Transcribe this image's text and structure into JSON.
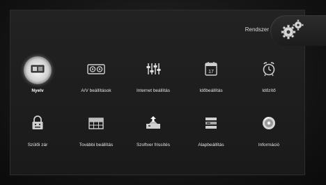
{
  "menu": {
    "title": "Rendszer"
  },
  "items": [
    {
      "label": "Nyelv",
      "icon": "language-icon",
      "selected": true
    },
    {
      "label": "A/V beállítások",
      "icon": "av-settings-icon"
    },
    {
      "label": "Internet beállítás",
      "icon": "internet-settings-icon"
    },
    {
      "label": "Időbeállítás",
      "icon": "calendar-icon",
      "calendar_day": "17"
    },
    {
      "label": "Időzítő",
      "icon": "alarm-clock-icon"
    },
    {
      "label": "Szülői zár",
      "icon": "parental-lock-icon"
    },
    {
      "label": "További beállítás",
      "icon": "more-settings-icon"
    },
    {
      "label": "Szoftver frissítés",
      "icon": "software-update-icon"
    },
    {
      "label": "Alapbeállítás",
      "icon": "factory-default-icon"
    },
    {
      "label": "Információ",
      "icon": "information-icon"
    }
  ]
}
